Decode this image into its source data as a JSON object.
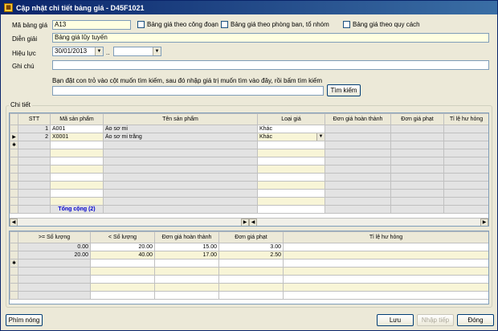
{
  "window": {
    "title": "Cập nhật chi tiết bảng giá - D45F1021",
    "icon": "app-icon"
  },
  "form": {
    "ma_bang_gia_label": "Mã bảng giá",
    "ma_bang_gia_value": "A13",
    "chk1_label": "Bảng giá theo công đoạn",
    "chk2_label": "Bảng giá theo phòng ban, tổ nhóm",
    "chk3_label": "Bảng giá theo quy cách",
    "dien_giai_label": "Diễn giải",
    "dien_giai_value": "Bảng giá lũy tuyến",
    "hieu_luc_label": "Hiệu lực",
    "hieu_luc_from": "30/01/2013",
    "hieu_luc_sep": "..",
    "hieu_luc_to": "",
    "ghi_chu_label": "Ghi chú",
    "ghi_chu_value": "",
    "search_hint": "Bạn đặt con trỏ vào cột muốn tìm kiếm, sau đó nhập giá trị muốn tìm vào đây, rồi bấm tìm kiếm",
    "search_value": "",
    "search_button": "Tìm kiếm"
  },
  "detail": {
    "group_title": "Chi tiết",
    "columns": [
      "STT",
      "Mã sản phẩm",
      "Tên sản phẩm",
      "Loại giá",
      "Đơn giá hoàn thành",
      "Đơn giá phạt",
      "Tỉ lệ hư hỏng"
    ],
    "rows": [
      {
        "stt": "1",
        "ma": "A001",
        "ten": "Áo sơ mi",
        "loai": "Khác"
      },
      {
        "stt": "2",
        "ma": "X0001",
        "ten": "Áo sơ mi trắng",
        "loai": "Khác"
      }
    ],
    "total_label": "Tổng cộng (2)"
  },
  "price": {
    "columns": [
      ">= Số lượng",
      "< Số lượng",
      "Đơn giá hoàn thành",
      "Đơn giá phạt",
      "Tỉ lệ hư hỏng"
    ],
    "rows": [
      {
        "min": "0.00",
        "max": "20.00",
        "dg": "15.00",
        "phat": "3.00",
        "tl": ""
      },
      {
        "min": "20.00",
        "max": "40.00",
        "dg": "17.00",
        "phat": "2.50",
        "tl": ""
      }
    ]
  },
  "footer": {
    "hotkey": "Phím nóng",
    "save": "Lưu",
    "next": "Nhập tiếp",
    "close": "Đóng"
  }
}
